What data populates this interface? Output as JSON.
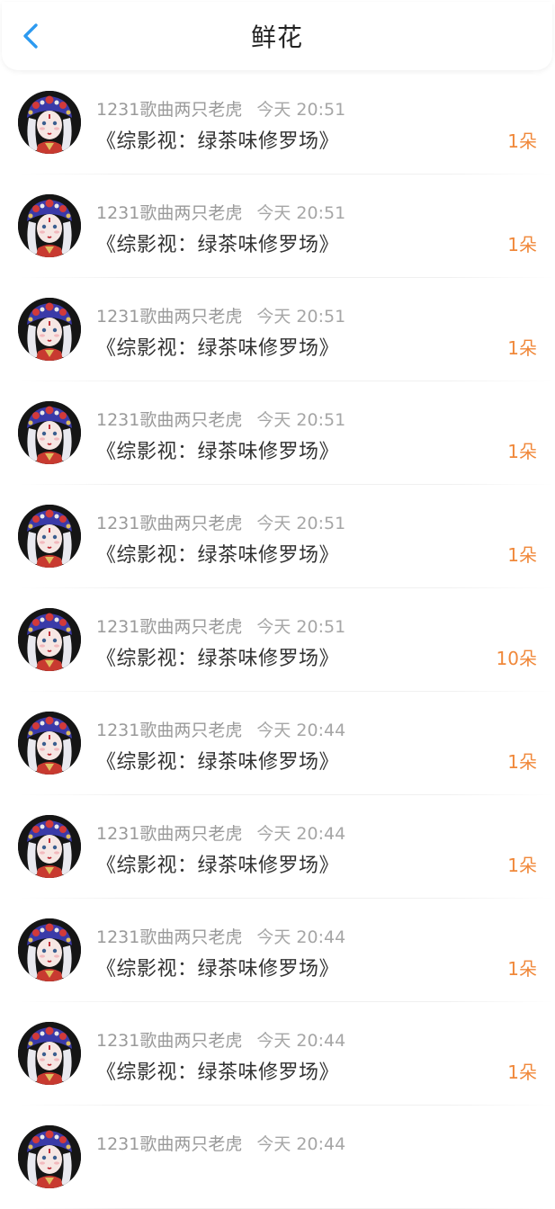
{
  "header": {
    "title": "鲜花",
    "back_icon": "chevron-left-icon",
    "accent_color": "#2d9af0"
  },
  "colors": {
    "count": "#f0883a"
  },
  "items": [
    {
      "user": "1231歌曲两只老虎",
      "time": "今天 20:51",
      "book": "《综影视：绿茶味修罗场》",
      "count": "1朵"
    },
    {
      "user": "1231歌曲两只老虎",
      "time": "今天 20:51",
      "book": "《综影视：绿茶味修罗场》",
      "count": "1朵"
    },
    {
      "user": "1231歌曲两只老虎",
      "time": "今天 20:51",
      "book": "《综影视：绿茶味修罗场》",
      "count": "1朵"
    },
    {
      "user": "1231歌曲两只老虎",
      "time": "今天 20:51",
      "book": "《综影视：绿茶味修罗场》",
      "count": "1朵"
    },
    {
      "user": "1231歌曲两只老虎",
      "time": "今天 20:51",
      "book": "《综影视：绿茶味修罗场》",
      "count": "1朵"
    },
    {
      "user": "1231歌曲两只老虎",
      "time": "今天 20:51",
      "book": "《综影视：绿茶味修罗场》",
      "count": "10朵"
    },
    {
      "user": "1231歌曲两只老虎",
      "time": "今天 20:44",
      "book": "《综影视：绿茶味修罗场》",
      "count": "1朵"
    },
    {
      "user": "1231歌曲两只老虎",
      "time": "今天 20:44",
      "book": "《综影视：绿茶味修罗场》",
      "count": "1朵"
    },
    {
      "user": "1231歌曲两只老虎",
      "time": "今天 20:44",
      "book": "《综影视：绿茶味修罗场》",
      "count": "1朵"
    },
    {
      "user": "1231歌曲两只老虎",
      "time": "今天 20:44",
      "book": "《综影视：绿茶味修罗场》",
      "count": "1朵"
    },
    {
      "user": "1231歌曲两只老虎",
      "time": "今天 20:44",
      "book": "",
      "count": ""
    }
  ]
}
